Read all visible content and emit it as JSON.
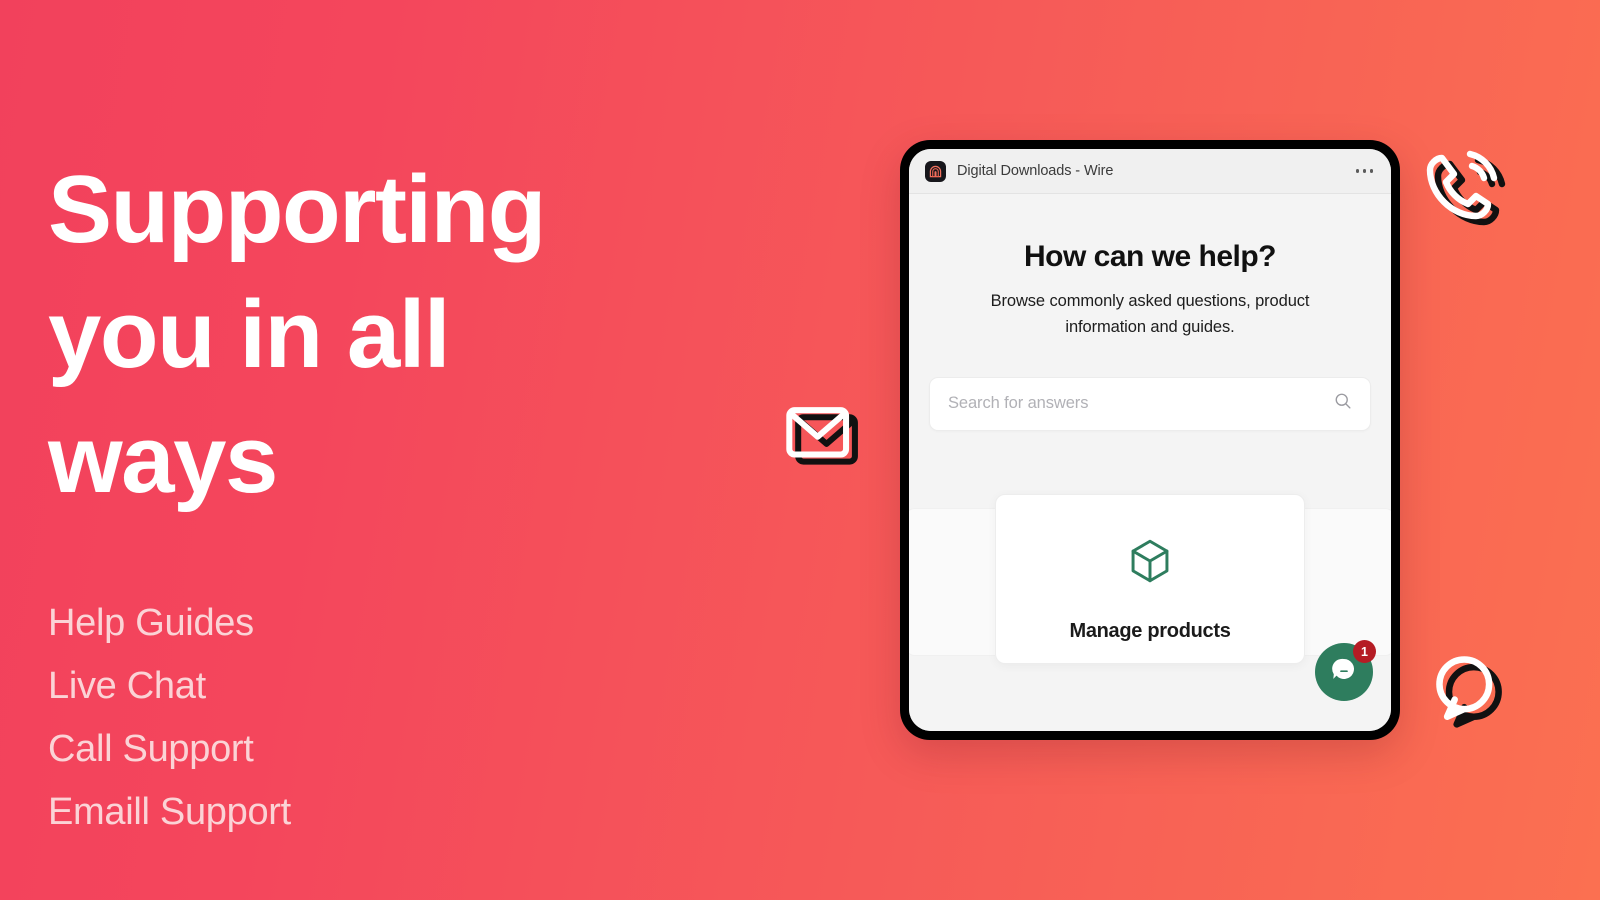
{
  "theme": {
    "gradient_start": "#f2415c",
    "gradient_end": "#fb7051",
    "headline_color": "#ffffff",
    "link_color": "#fbd3d6",
    "chat_accent": "#2e7d5e",
    "badge_color": "#b51c24",
    "cube_icon_color": "#2e7d5e"
  },
  "hero": {
    "title": "Supporting you in all ways",
    "links": [
      {
        "label": "Help Guides"
      },
      {
        "label": "Live Chat"
      },
      {
        "label": "Call Support"
      },
      {
        "label": "Emaill Support"
      }
    ]
  },
  "decorations": [
    {
      "name": "phone-icon",
      "label": "Call Support"
    },
    {
      "name": "envelope-icon",
      "label": "Email Support"
    },
    {
      "name": "speech-bubble-icon",
      "label": "Live Chat"
    }
  ],
  "device": {
    "titlebar": {
      "app_icon": "wire-app-icon",
      "title": "Digital Downloads - Wire",
      "menu_icon": "more-options-icon"
    },
    "help_center": {
      "heading": "How can we help?",
      "subtitle": "Browse commonly asked questions, product information and guides.",
      "search": {
        "placeholder": "Search for answers",
        "value": "",
        "icon": "search-icon"
      },
      "cards": [
        {
          "icon": "cube-icon",
          "label": "Manage products"
        }
      ]
    },
    "chat_widget": {
      "icon": "chat-bubble-icon",
      "badge_count": "1"
    }
  }
}
